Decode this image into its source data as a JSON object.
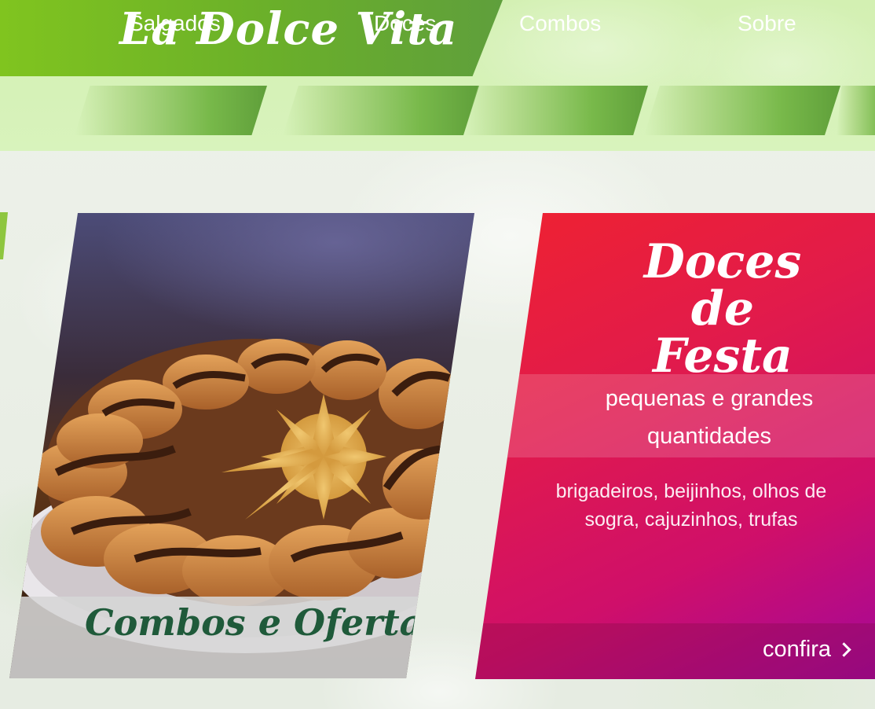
{
  "brand": {
    "logo_text": "La Dolce Vita"
  },
  "nav": {
    "items": [
      {
        "label": "Salgados"
      },
      {
        "label": "Doces"
      },
      {
        "label": "Combos"
      },
      {
        "label": "Sobre"
      }
    ]
  },
  "combos_card": {
    "caption": "Combos e Ofertas",
    "image": "swirl-bread-photo"
  },
  "doces_card": {
    "title": "Doces de Festa",
    "subtitle": "pequenas e grandes quantidades",
    "description": "brigadeiros, beijinhos, olhos de sogra, cajuzinhos, trufas",
    "cta_label": "confira",
    "cta_icon": "chevron-right-icon"
  },
  "colors": {
    "brand_green": "#6aaf2a",
    "header_bg": "#d3f0b2",
    "card_red": "#ef2230",
    "card_magenta": "#a3089a",
    "caption_green": "#1f5a3a"
  }
}
